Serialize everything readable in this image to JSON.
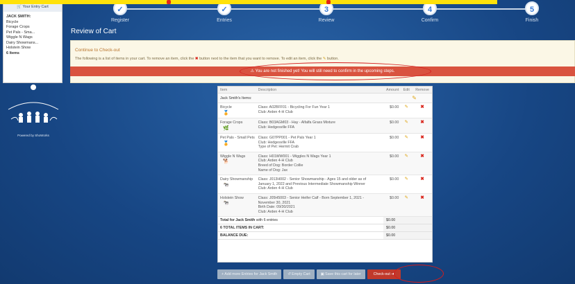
{
  "steps": [
    {
      "label": "Register",
      "done": true
    },
    {
      "label": "Entries",
      "done": true
    },
    {
      "label": "Review",
      "number": "3"
    },
    {
      "label": "Confirm",
      "number": "4"
    },
    {
      "label": "Finish",
      "number": "5"
    }
  ],
  "cart": {
    "title": "Your Entry Cart",
    "exhibitor": "JACK SMITH:",
    "items": [
      "Bicycle",
      "Forage Crops",
      "Pet Pals - Sma...",
      "Wiggle N Wags",
      "Dairy Showmans...",
      "Holstein Show"
    ],
    "count": "6 Items"
  },
  "sidebar": {
    "powered_by": "Powered by ShoWorks"
  },
  "page_title": "Review of Cart",
  "notice": {
    "title": "Continue to Check-out",
    "text_before_x": "The following is a list of items in your cart. To remove an item, click the",
    "text_after_x": "button next to the item that you want to remove. To edit an item, click the",
    "text_end": "button.",
    "warning": "You are not finished yet! You will still need to confirm in the upcoming steps."
  },
  "table": {
    "headers": [
      "Item",
      "Description",
      "Amount",
      "Edit",
      "Remove"
    ],
    "section": "Jack Smith's Items:",
    "rows": [
      {
        "item": "Bicycle",
        "icon": "ribbon-icon",
        "lines": [
          "Class: A02BFF01 - Bicycling For Fun Year 1",
          "Club: Arden 4-H Club"
        ],
        "amount": "$0.00"
      },
      {
        "item": "Forage Crops",
        "icon": "plant-icon",
        "lines": [
          "Class: B03AGM03 - Hay - Alfalfa Grass Mixture",
          "Club: Hedgesville FFA"
        ],
        "amount": "$0.00"
      },
      {
        "item": "Pet Pals - Small Pets",
        "icon": "ribbon-icon",
        "lines": [
          "Class: G07PP001 - Pet Pals Year 1",
          "Club: Hedgesville FFA",
          "Type of Pet: Hermit Crab"
        ],
        "amount": "$0.00"
      },
      {
        "item": "Wiggle N Wags",
        "icon": "dog-icon",
        "lines": [
          "Class: H01WW001 - Wiggles N Wags Year 1",
          "Club: Arden 4-H Club",
          "Breed of Dog: Border Collie",
          "Name of Dog: Jax"
        ],
        "amount": "$0.00"
      },
      {
        "item": "Dairy Showmanship",
        "icon": "cow-icon",
        "lines": [
          "Class: J013H002 - Senior Showmanship - Ages 15 and older as of",
          "January 1, 2022 and Previous Intermediate Showmanship Winner",
          "Club: Arden 4-H Club"
        ],
        "amount": "$0.00"
      },
      {
        "item": "Holstein Show",
        "icon": "cow-icon",
        "lines": [
          "Class: J05H5003 - Senior Heifer Calf - Born September 1, 2021 -",
          "November 30, 2021",
          "Birth Date: 09/30/2021",
          "Club: Arden 4-H Club"
        ],
        "amount": "$0.00"
      }
    ],
    "totals": [
      {
        "label_bold": "Total for Jack Smith",
        "label_rest": " with 6 entries",
        "value": "$0.00"
      },
      {
        "label_bold": "6 TOTAL ITEMS IN CART:",
        "label_rest": "",
        "value": "$0.00"
      },
      {
        "label_bold": "BALANCE DUE:",
        "label_rest": "",
        "value": "$0.00"
      }
    ]
  },
  "buttons": {
    "add": "Add more Entries for Jack Smith",
    "empty": "Empty Cart",
    "save": "Save this cart for later",
    "checkout": "Check-out"
  }
}
